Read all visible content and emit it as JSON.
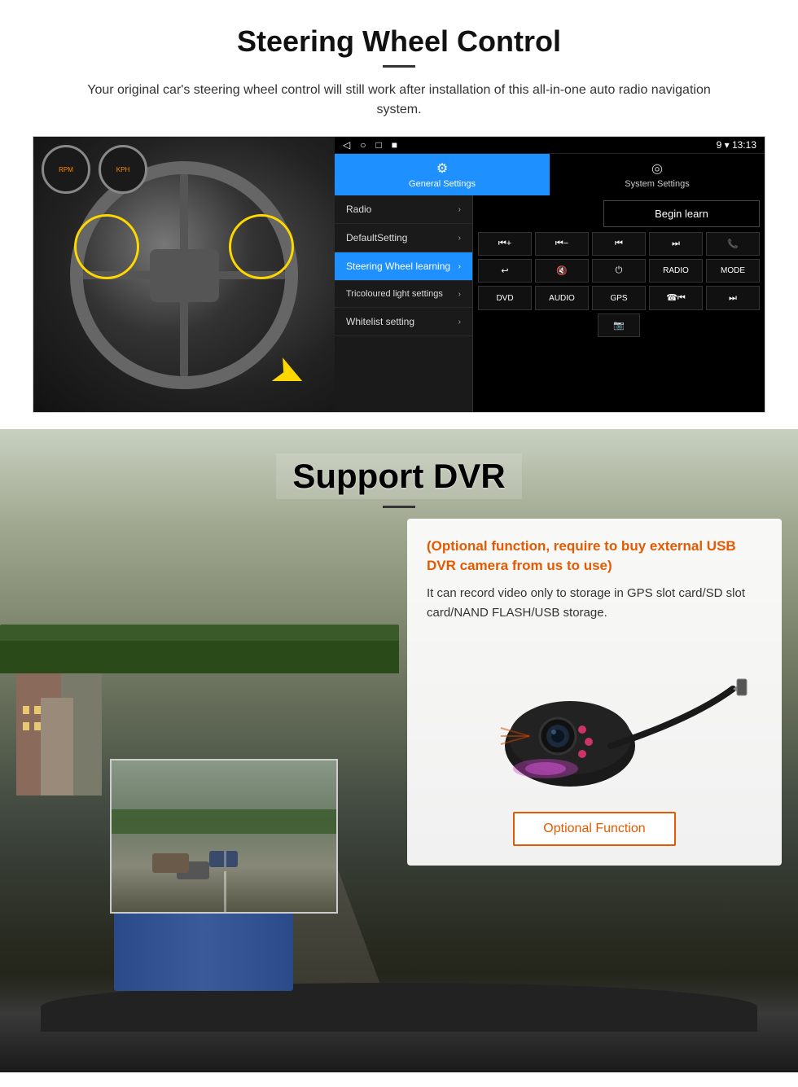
{
  "page": {
    "section1": {
      "title": "Steering Wheel Control",
      "subtitle": "Your original car's steering wheel control will still work after installation of this all-in-one auto radio navigation system.",
      "android_ui": {
        "statusbar": {
          "icons": [
            "◁",
            "○",
            "□",
            "■"
          ],
          "right": "9 ▾ 13:13"
        },
        "tabs": [
          {
            "icon": "⚙",
            "label": "General Settings",
            "active": true
          },
          {
            "icon": "◎",
            "label": "System Settings",
            "active": false
          }
        ],
        "menu_items": [
          {
            "label": "Radio",
            "active": false
          },
          {
            "label": "DefaultSetting",
            "active": false
          },
          {
            "label": "Steering Wheel learning",
            "active": true
          },
          {
            "label": "Tricoloured light settings",
            "active": false
          },
          {
            "label": "Whitelist setting",
            "active": false
          }
        ],
        "begin_learn": "Begin learn",
        "buttons_row1": [
          "⏮+",
          "⏮-",
          "⏮⏮",
          "⏭⏭",
          "☎"
        ],
        "buttons_row2": [
          "↩",
          "🔇",
          "⏻",
          "RADIO",
          "MODE"
        ],
        "buttons_row3": [
          "DVD",
          "AUDIO",
          "GPS",
          "☎⏮",
          "⏭"
        ],
        "buttons_row4_icon": "📷"
      }
    },
    "section2": {
      "title": "Support DVR",
      "card": {
        "optional_text": "(Optional function, require to buy external USB DVR camera from us to use)",
        "desc_text": "It can record video only to storage in GPS slot card/SD slot card/NAND FLASH/USB storage.",
        "optional_btn": "Optional Function"
      }
    }
  }
}
